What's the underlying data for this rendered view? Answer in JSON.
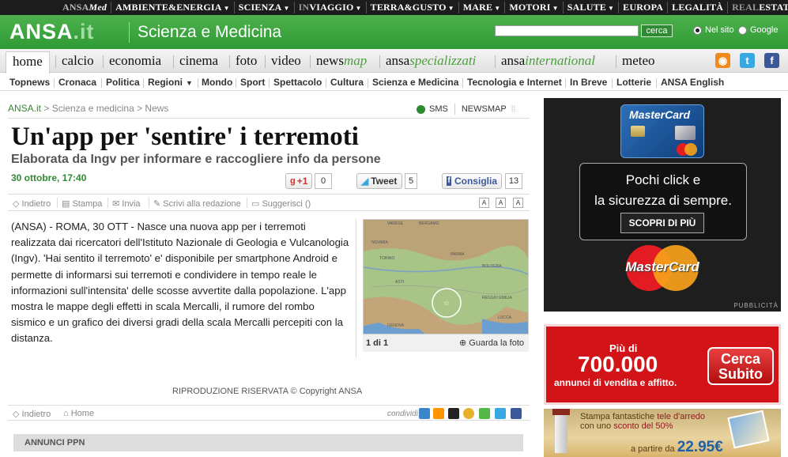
{
  "topnav": {
    "items": [
      {
        "label": "ANSA",
        "label2": "Med"
      },
      {
        "label": "AMBIENTE&ENERGIA"
      },
      {
        "label": "SCIENZA"
      },
      {
        "label": "IN",
        "label2": "VIAGGIO"
      },
      {
        "label": "TERRA&GUSTO"
      },
      {
        "label": "MARE"
      },
      {
        "label": "MOTORI"
      },
      {
        "label": "SALUTE"
      },
      {
        "label": "EUROPA"
      },
      {
        "label": "LEGALITÀ"
      },
      {
        "label": "REAL",
        "label2": "ESTATE"
      }
    ]
  },
  "header": {
    "logo_main": "ANSA",
    "logo_suffix": ".it",
    "section_title": "Scienza e Medicina",
    "search_button": "cerca",
    "radio_site": "Nel sito",
    "radio_google": "Google"
  },
  "mainnav": {
    "home": "home",
    "calcio": "calcio",
    "economia": "economia",
    "cinema": "cinema",
    "foto": "foto",
    "video": "video",
    "newsmap_a": "news",
    "newsmap_b": "map",
    "spec_a": "ansa",
    "spec_b": "specializzati",
    "intl_a": "ansa",
    "intl_b": "international",
    "meteo": "meteo"
  },
  "subnav": {
    "items": [
      "Topnews",
      "Cronaca",
      "Politica",
      "Regioni",
      "Mondo",
      "Sport",
      "Spettacolo",
      "Cultura",
      "Scienza e Medicina",
      "Tecnologia e Internet",
      "In Breve",
      "Lotterie",
      "ANSA English"
    ]
  },
  "breadcrumb": {
    "root": "ANSA.it",
    "rest": " > Scienza e medicina > News"
  },
  "toptools": {
    "sms": "SMS",
    "newsmap": "NEWSMAP"
  },
  "article": {
    "headline": "Un'app per 'sentire' i terremoti",
    "subheadline": "Elaborata da Ingv per informare e raccogliere info da persone",
    "date": "30 ottobre, 17:40",
    "body": "(ANSA) - ROMA, 30 OTT - Nasce una nuova app per i terremoti realizzata dai ricercatori dell'Istituto Nazionale di Geologia e Vulcanologia (Ingv). 'Hai sentito il terremoto' e' disponibile per smartphone Android e permette di informarsi sui terremoti e condividere in tempo reale le informazioni sull'intensita' delle scosse avvertite dalla popolazione. L'app mostra le mappe degli effetti in scala Mercalli, il rumore del rombo sismico e un grafico dei diversi gradi della scala Mercalli percepiti con la distanza.",
    "copyright": "RIPRODUZIONE RISERVATA © Copyright ANSA"
  },
  "share": {
    "gplus_label": "+1",
    "gplus_count": "0",
    "tweet_label": "Tweet",
    "tweet_count": "5",
    "fb_label": "Consiglia",
    "fb_count": "13"
  },
  "tools": {
    "back": "Indietro",
    "print": "Stampa",
    "send": "Invia",
    "write": "Scrivi alla redazione",
    "suggest": "Suggerisci ()"
  },
  "photo": {
    "counter": "1 di 1",
    "view": "Guarda la foto"
  },
  "bottomtools": {
    "back": "Indietro",
    "home": "Home",
    "share_label": "condividi:"
  },
  "annunci": "ANNUNCI PPN",
  "ads": {
    "mastercard_card": "MasterCard",
    "mastercard_line1": "Pochi click e",
    "mastercard_line2": "la sicurezza di sempre.",
    "mastercard_button": "SCOPRI DI PIÙ",
    "mastercard_logo": "MasterCard",
    "pubblicita": "PUBBLICITÀ",
    "casa_piu": "Più di",
    "casa_number": "700.000",
    "casa_sub": "annunci di vendita e affitto.",
    "casa_button_1": "Cerca",
    "casa_button_2": "Subito",
    "arredo_line1_a": "Stampa fantastiche ",
    "arredo_line1_b": "tele d'arredo",
    "arredo_line2_a": "con uno ",
    "arredo_line2_b": "sconto del 50%",
    "arredo_price_prefix": "a partire da ",
    "arredo_price": "22.95",
    "arredo_currency": "€"
  },
  "colors": {
    "brand_green": "#2f9a34",
    "topbar": "#1c1c1c",
    "ad_red": "#d21418"
  }
}
